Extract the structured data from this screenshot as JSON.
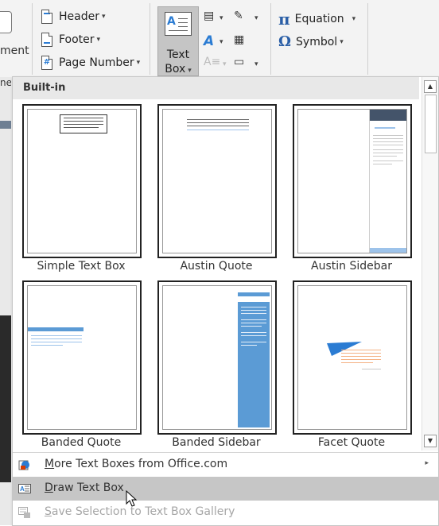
{
  "ribbon": {
    "left_fragment": "ment",
    "header_label": "Header",
    "footer_label": "Footer",
    "page_number_label": "Page Number",
    "text_box_label_line1": "Text",
    "text_box_label_line2": "Box",
    "equation_label": "Equation",
    "symbol_label": "Symbol",
    "equation_glyph": "π",
    "symbol_glyph": "Ω",
    "caret": "▾"
  },
  "left_strip": {
    "fragment": "ne"
  },
  "gallery": {
    "section_title": "Built-in",
    "items": [
      {
        "caption": "Simple Text Box"
      },
      {
        "caption": "Austin Quote"
      },
      {
        "caption": "Austin Sidebar"
      },
      {
        "caption": "Banded Quote"
      },
      {
        "caption": "Banded Sidebar"
      },
      {
        "caption": "Facet Quote"
      }
    ]
  },
  "scrollbar": {
    "up": "▲",
    "down": "▼"
  },
  "menu": {
    "more": {
      "prefix": "M",
      "rest": "ore Text Boxes from Office.com",
      "arrow": "▸"
    },
    "draw": {
      "prefix": "D",
      "rest": "raw Text Box"
    },
    "save": {
      "prefix": "S",
      "rest": "ave Selection to Text Box Gallery"
    }
  },
  "colors": {
    "accent_blue": "#2b7cd3",
    "highlight": "#c6c6c6",
    "disabled_text": "#a6a6a6",
    "austin_sidebar_top": "#44546a",
    "banded_blue": "#5b9bd5"
  }
}
